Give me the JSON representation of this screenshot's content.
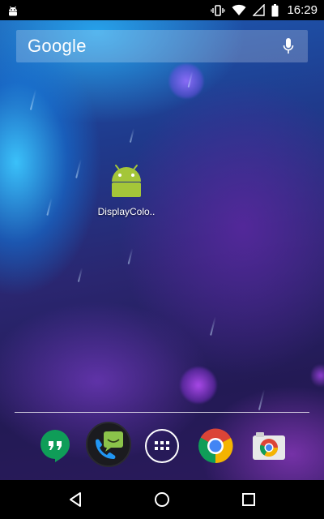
{
  "status_bar": {
    "time": "16:29",
    "icons": [
      "android-debug-icon",
      "vibrate-icon",
      "wifi-icon",
      "signal-icon",
      "battery-icon"
    ]
  },
  "search": {
    "logo_text": "Google",
    "mic_icon": "mic-icon"
  },
  "home": {
    "apps": [
      {
        "label": "DisplayColo..",
        "icon": "android-robot-icon",
        "color": "#a4c639"
      }
    ]
  },
  "dock": {
    "items": [
      {
        "name": "hangouts",
        "icon": "hangouts-icon",
        "color": "#0f9d58"
      },
      {
        "name": "messaging",
        "icon": "messenger-icon",
        "color": "#8bc34a"
      },
      {
        "name": "all-apps",
        "icon": "app-drawer-icon",
        "color": "#ffffff"
      },
      {
        "name": "chrome",
        "icon": "chrome-icon",
        "color": "#db4437"
      },
      {
        "name": "camera",
        "icon": "camera-icon",
        "color": "#e0e0e0"
      }
    ]
  },
  "nav_bar": {
    "buttons": [
      "back-icon",
      "home-icon",
      "recents-icon"
    ]
  }
}
